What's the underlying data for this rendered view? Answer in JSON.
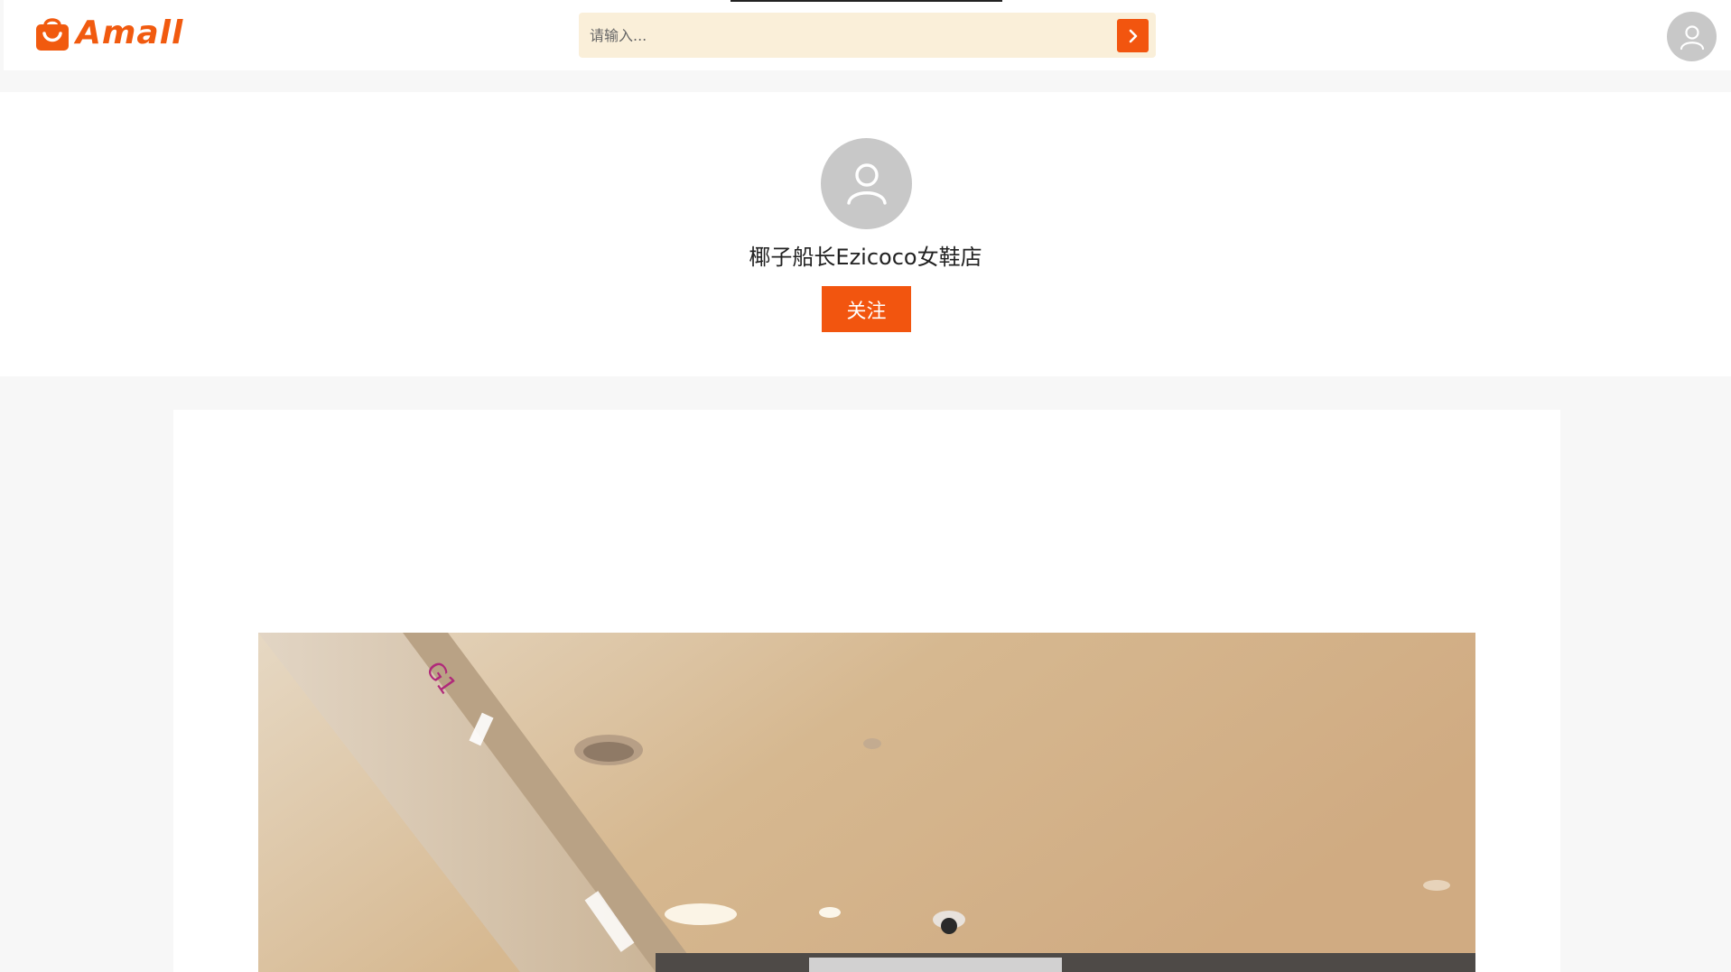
{
  "header": {
    "logo_text": "Amall",
    "search": {
      "placeholder": "请输入...",
      "value": ""
    },
    "icons": {
      "search_button": "chevron-right-icon",
      "user": "user-icon"
    }
  },
  "shop": {
    "name": "椰子船长Ezicoco女鞋店",
    "follow_label": "关注",
    "avatar_icon": "user-icon"
  },
  "colors": {
    "accent": "#f2550f",
    "search_bg": "#faefd9",
    "avatar_gray": "#c8c8c8",
    "page_bg": "#f7f7f7"
  }
}
